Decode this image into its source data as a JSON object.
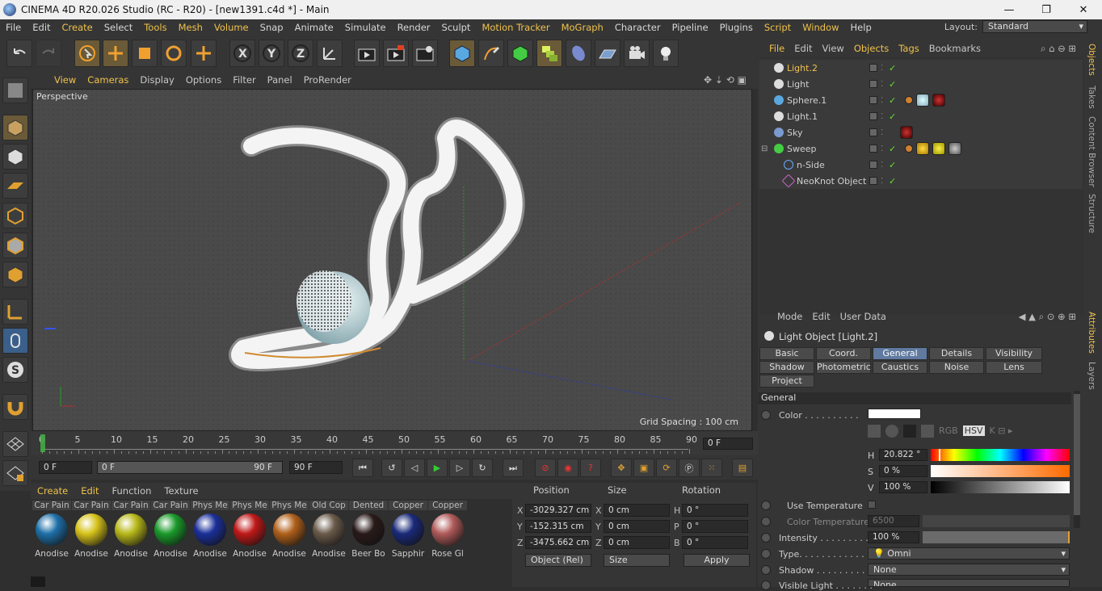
{
  "window": {
    "title": "CINEMA 4D R20.026 Studio (RC - R20) - [new1391.c4d *] - Main"
  },
  "menu": [
    "File",
    "Edit",
    "Create",
    "Select",
    "Tools",
    "Mesh",
    "Volume",
    "Snap",
    "Animate",
    "Simulate",
    "Render",
    "Sculpt",
    "Motion Tracker",
    "MoGraph",
    "Character",
    "Pipeline",
    "Plugins",
    "Script",
    "Window",
    "Help"
  ],
  "layout": {
    "label": "Layout:",
    "value": "Standard"
  },
  "viewport": {
    "menu": [
      "View",
      "Cameras",
      "Display",
      "Options",
      "Filter",
      "Panel",
      "ProRender"
    ],
    "camera": "Perspective",
    "grid_spacing": "Grid Spacing : 100 cm"
  },
  "timeline": {
    "ticks": [
      "0",
      "5",
      "10",
      "15",
      "20",
      "25",
      "30",
      "35",
      "40",
      "45",
      "50",
      "55",
      "60",
      "65",
      "70",
      "75",
      "80",
      "85",
      "90"
    ],
    "current_frame": "0 F"
  },
  "transport": {
    "start": "0 F",
    "range_start": "0 F",
    "range_end": "90 F",
    "end": "90 F"
  },
  "materials": {
    "menu": [
      "Create",
      "Edit",
      "Function",
      "Texture"
    ],
    "items": [
      {
        "name": "Car Pain",
        "label": "Anodise",
        "color": "#1e6fa8"
      },
      {
        "name": "Car Pain",
        "label": "Anodise",
        "color": "#d6c21a"
      },
      {
        "name": "Car Pain",
        "label": "Anodise",
        "color": "#b8b81a"
      },
      {
        "name": "Car Pain",
        "label": "Anodise",
        "color": "#1a9a2a"
      },
      {
        "name": "Phys Me",
        "label": "Anodise",
        "color": "#1a2f9a"
      },
      {
        "name": "Phys Me",
        "label": "Anodise",
        "color": "#c01818"
      },
      {
        "name": "Phys Me",
        "label": "Anodise",
        "color": "#b0601a"
      },
      {
        "name": "Old Cop",
        "label": "Anodise",
        "color": "#6a5a4a"
      },
      {
        "name": "Dented",
        "label": "Beer Bo",
        "color": "#2a1a1a"
      },
      {
        "name": "Copper",
        "label": "Sapphir",
        "color": "#1a2a7a"
      },
      {
        "name": "Copper",
        "label": "Rose Gl",
        "color": "#b05a5a"
      }
    ]
  },
  "coords": {
    "headers": [
      "Position",
      "Size",
      "Rotation"
    ],
    "rows": [
      {
        "axis": "X",
        "pos": "-3029.327 cm",
        "saxis": "X",
        "size": "0 cm",
        "raxis": "H",
        "rot": "0 °"
      },
      {
        "axis": "Y",
        "pos": "-152.315 cm",
        "saxis": "Y",
        "size": "0 cm",
        "raxis": "P",
        "rot": "0 °"
      },
      {
        "axis": "Z",
        "pos": "-3475.662 cm",
        "saxis": "Z",
        "size": "0 cm",
        "raxis": "B",
        "rot": "0 °"
      }
    ],
    "mode": "Object (Rel)",
    "size_mode": "Size",
    "apply": "Apply"
  },
  "objects": {
    "menu": [
      "File",
      "Edit",
      "View",
      "Objects",
      "Tags",
      "Bookmarks"
    ],
    "items": [
      {
        "name": "Light.2",
        "icon": "light-icon"
      },
      {
        "name": "Light",
        "icon": "light-icon"
      },
      {
        "name": "Sphere.1",
        "icon": "sphere-icon"
      },
      {
        "name": "Light.1",
        "icon": "light-icon"
      },
      {
        "name": "Sky",
        "icon": "sky-icon"
      },
      {
        "name": "Sweep",
        "icon": "sweep-icon"
      },
      {
        "name": "n-Side",
        "icon": "nside-icon"
      },
      {
        "name": "NeoKnot Object",
        "icon": "neoknot-icon"
      }
    ]
  },
  "attributes": {
    "menu": [
      "Mode",
      "Edit",
      "User Data"
    ],
    "title": "Light Object [Light.2]",
    "tabs": [
      "Basic",
      "Coord.",
      "General",
      "Details",
      "Visibility",
      "Shadow",
      "Photometric",
      "Caustics",
      "Noise",
      "Lens",
      "Project"
    ],
    "active_tab": "General",
    "section": "General",
    "color_label": "Color . . . . . . . . . .",
    "h_label": "H",
    "h_value": "20.822 °",
    "s_label": "S",
    "s_value": "0 %",
    "v_label": "V",
    "v_value": "100 %",
    "use_temp": "Use Temperature",
    "color_temp": "Color Temperature",
    "color_temp_value": "6500",
    "intensity_label": "Intensity . . . . . . . . .",
    "intensity_value": "100 %",
    "intensity_fill": 1.0,
    "type_label": "Type. . . . . . . . . . . . .",
    "type_value": "Omni",
    "shadow_label": "Shadow . . . . . . . . .",
    "shadow_value": "None",
    "visible_label": "Visible Light . . . . . . .",
    "visible_value": "None",
    "color_mode": "HSV"
  },
  "sidetabs": [
    "Objects",
    "Takes",
    "Content Browser",
    "Structure",
    "Attributes",
    "Layers"
  ]
}
